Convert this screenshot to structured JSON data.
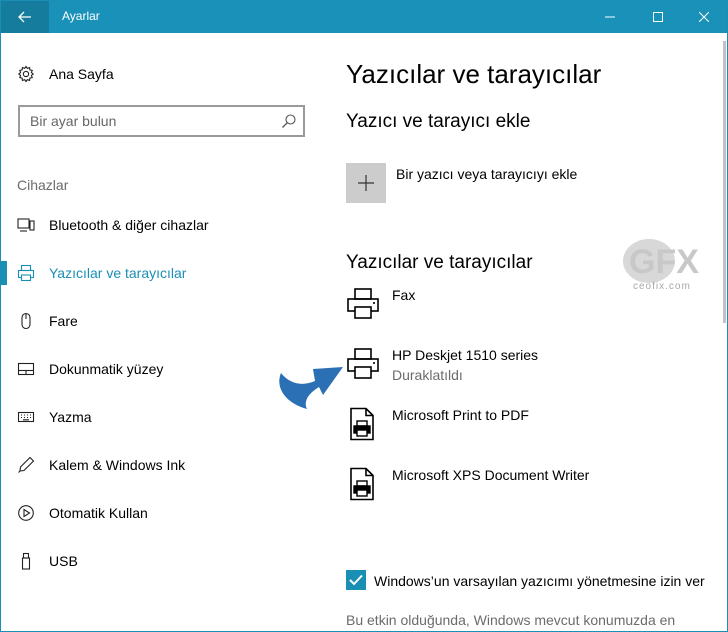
{
  "window": {
    "title": "Ayarlar",
    "accent_color": "#1a91b8",
    "controls": [
      "minimize-icon",
      "maximize-icon",
      "close-icon"
    ]
  },
  "sidebar": {
    "home_label": "Ana Sayfa",
    "search_placeholder": "Bir ayar bulun",
    "section_label": "Cihazlar",
    "items": [
      {
        "label": "Bluetooth & diğer cihazlar",
        "icon": "bluetooth-devices-icon",
        "active": false
      },
      {
        "label": "Yazıcılar ve tarayıcılar",
        "icon": "printer-icon",
        "active": true
      },
      {
        "label": "Fare",
        "icon": "mouse-icon",
        "active": false
      },
      {
        "label": "Dokunmatik yüzey",
        "icon": "touchpad-icon",
        "active": false
      },
      {
        "label": "Yazma",
        "icon": "keyboard-icon",
        "active": false
      },
      {
        "label": "Kalem & Windows Ink",
        "icon": "pen-icon",
        "active": false
      },
      {
        "label": "Otomatik Kullan",
        "icon": "autoplay-icon",
        "active": false
      },
      {
        "label": "USB",
        "icon": "usb-icon",
        "active": false
      }
    ]
  },
  "main": {
    "page_title": "Yazıcılar ve tarayıcılar",
    "add_section_title": "Yazıcı ve tarayıcı ekle",
    "add_button_label": "Bir yazıcı veya tarayıcıyı ekle",
    "devices_section_title": "Yazıcılar ve tarayıcılar",
    "devices": [
      {
        "name": "Fax",
        "status": "",
        "icon": "printer-icon"
      },
      {
        "name": "HP Deskjet 1510 series",
        "status": "Duraklatıldı",
        "icon": "printer-icon"
      },
      {
        "name": "Microsoft Print to PDF",
        "status": "",
        "icon": "document-printer-icon"
      },
      {
        "name": "Microsoft XPS Document Writer",
        "status": "",
        "icon": "document-printer-icon"
      }
    ],
    "default_printer_checkbox": {
      "label": "Windows’un varsayılan yazıcımı yönetmesine izin ver",
      "checked": true
    },
    "default_printer_note": "Bu etkin olduğunda, Windows mevcut konumuzda en"
  },
  "watermark": {
    "logo_text": "GFX",
    "site_text": "ceofix.com"
  }
}
